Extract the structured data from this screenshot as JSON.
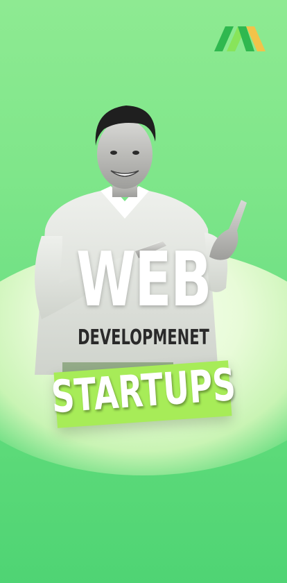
{
  "poster": {
    "headline": "WEB",
    "subheadline": "DEVELOPMENET",
    "banner": "STARTUPS"
  },
  "brand": {
    "logo_icon": "zigzag-logo-icon",
    "colors": [
      "#2fb84f",
      "#88e45a",
      "#f2c34a"
    ]
  },
  "colors": {
    "background": "#6ee083",
    "banner": "#a7ec58",
    "headline": "#ffffff",
    "subheadline": "#2a2a2a"
  }
}
